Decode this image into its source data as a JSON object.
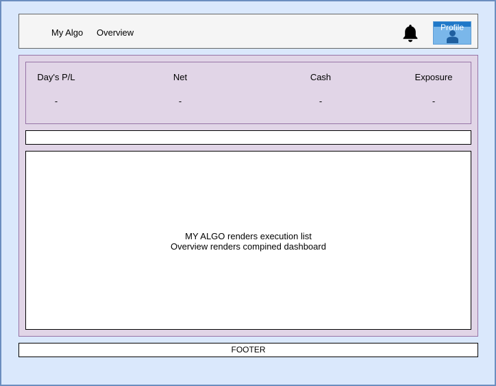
{
  "header": {
    "nav": [
      {
        "label": "My Algo"
      },
      {
        "label": "Overview"
      }
    ],
    "notification_icon": "bell-icon",
    "profile": {
      "label": "Profile",
      "icon": "user-icon"
    }
  },
  "stats": [
    {
      "label": "Day's P/L",
      "value": "-"
    },
    {
      "label": "Net",
      "value": "-"
    },
    {
      "label": "Cash",
      "value": "-"
    },
    {
      "label": "Exposure",
      "value": "-"
    }
  ],
  "content": {
    "line1": "MY ALGO renders execution list",
    "line2": "Overview renders compined dashboard"
  },
  "footer": {
    "label": "FOOTER"
  },
  "colors": {
    "background": "#dae8fc",
    "background_border": "#6c8ebf",
    "header": "#f5f5f5",
    "main": "#e1d5e7",
    "main_border": "#9673a6",
    "profile": "#7ab7ea",
    "profile_bar": "#1f78c8"
  }
}
